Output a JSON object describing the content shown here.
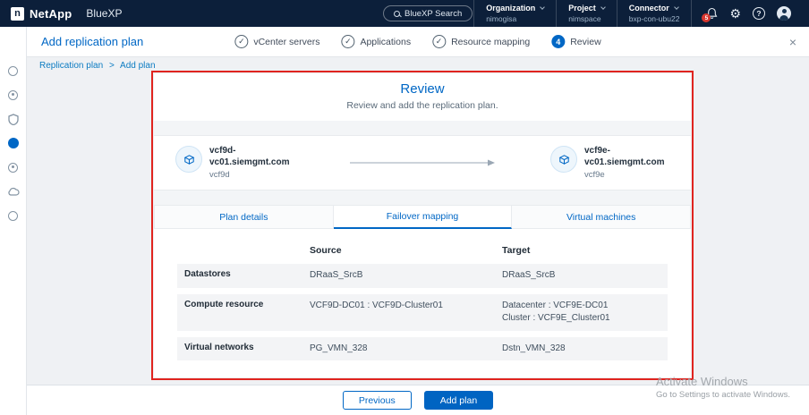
{
  "colors": {
    "accent": "#0067c5",
    "header_bg": "#0c1f3a",
    "primary_button": "#0064c2",
    "annotation_red": "#e0241f",
    "notification_badge": "#d8372f"
  },
  "header": {
    "brand": "NetApp",
    "logo_letter": "n",
    "product": "BlueXP",
    "search_label": "BlueXP Search",
    "organization": {
      "label": "Organization",
      "value": "nimogisa"
    },
    "project": {
      "label": "Project",
      "value": "nimspace"
    },
    "connector": {
      "label": "Connector",
      "value": "bxp-con-ubu22"
    },
    "notification_count": "5",
    "help_glyph": "?",
    "icons": {
      "gear": "⚙"
    }
  },
  "sidebar": {
    "items": [
      "backup-icon",
      "sync-icon",
      "protection-icon",
      "disaster-recovery-icon",
      "replication-icon",
      "cloud-icon",
      "settings-icon"
    ],
    "active_index": 3
  },
  "wizard": {
    "title": "Add replication plan",
    "close_glyph": "×",
    "steps": [
      {
        "label": "vCenter servers",
        "glyph": "✓",
        "state": "done"
      },
      {
        "label": "Applications",
        "glyph": "✓",
        "state": "done"
      },
      {
        "label": "Resource mapping",
        "glyph": "✓",
        "state": "done"
      },
      {
        "label": "Review",
        "glyph": "4",
        "state": "active"
      }
    ]
  },
  "breadcrumb": {
    "parent": "Replication plan",
    "separator": ">",
    "current": "Add plan"
  },
  "review": {
    "title": "Review",
    "subtitle": "Review and add the replication plan.",
    "source_vcenter": {
      "name": "vcf9d-vc01.siemgmt.com",
      "id": "vcf9d"
    },
    "target_vcenter": {
      "name": "vcf9e-vc01.siemgmt.com",
      "id": "vcf9e"
    },
    "tabs": [
      "Plan details",
      "Failover mapping",
      "Virtual machines"
    ],
    "active_tab_index": 1,
    "table": {
      "col_source": "Source",
      "col_target": "Target",
      "rows": [
        {
          "label": "Datastores",
          "source": "DRaaS_SrcB",
          "target_line1": "DRaaS_SrcB",
          "target_line2": ""
        },
        {
          "label": "Compute resource",
          "source": "VCF9D-DC01 : VCF9D-Cluster01",
          "target_line1": "Datacenter : VCF9E-DC01",
          "target_line2": "Cluster : VCF9E_Cluster01"
        },
        {
          "label": "Virtual networks",
          "source": "PG_VMN_328",
          "target_line1": "Dstn_VMN_328",
          "target_line2": ""
        }
      ]
    }
  },
  "footer": {
    "previous": "Previous",
    "add_plan": "Add plan"
  },
  "watermark": {
    "title": "Activate Windows",
    "subtitle": "Go to Settings to activate Windows."
  }
}
